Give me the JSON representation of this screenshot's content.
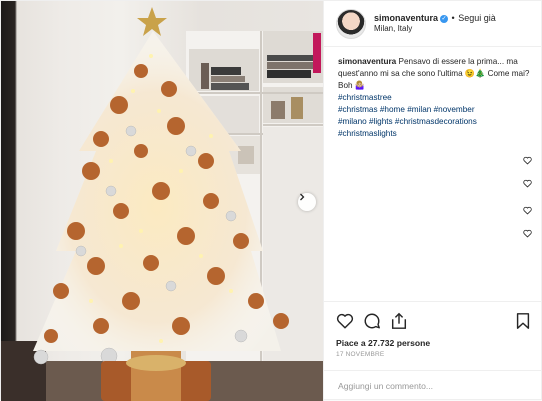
{
  "post": {
    "username": "simonaventura",
    "follow_label": "Segui già",
    "separator": "•",
    "location": "Milan, Italy",
    "verified_mark": "✓",
    "caption": {
      "user": "simonaventura",
      "text": "Pensavo di essere la prima... ma quest'anno mi sa che sono l'ultima 😉🎄 Come mai? Boh 🤷🏼‍♀️",
      "hashtags": [
        "#christmastree",
        "#christmas",
        "#home",
        "#milan",
        "#november",
        "#milano",
        "#lights",
        "#christmasdecorations",
        "#christmaslights"
      ]
    },
    "likes_prefix": "Piace a",
    "likes_count": "27.732",
    "likes_suffix": "persone",
    "date": "17 NOVEMBRE",
    "comment_placeholder": "Aggiungi un commento...",
    "icons": {
      "like": "heart-icon",
      "comment": "comment-icon",
      "share": "share-icon",
      "save": "bookmark-icon",
      "next": "chevron-right-icon"
    },
    "colors": {
      "hashtag": "#003569",
      "verified": "#3897f0",
      "ornament_copper": "#b5652f",
      "ornament_silver": "#d9d9d9"
    }
  }
}
